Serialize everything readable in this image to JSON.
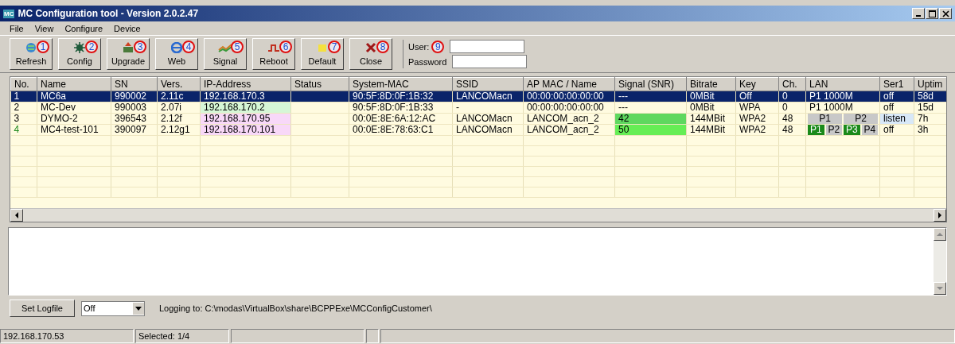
{
  "window": {
    "title": "MC Configuration tool - Version 2.0.2.47",
    "logo": "MC"
  },
  "menu": [
    "File",
    "View",
    "Configure",
    "Device"
  ],
  "toolbar": [
    {
      "label": "Refresh",
      "callout": "1"
    },
    {
      "label": "Config",
      "callout": "2"
    },
    {
      "label": "Upgrade",
      "callout": "3"
    },
    {
      "label": "Web",
      "callout": "4"
    },
    {
      "label": "Signal",
      "callout": "5"
    },
    {
      "label": "Reboot",
      "callout": "6"
    },
    {
      "label": "Default",
      "callout": "7"
    },
    {
      "label": "Close",
      "callout": "8"
    }
  ],
  "login": {
    "user_label": "User:",
    "callout": "9",
    "password_label": "Password"
  },
  "table": {
    "columns": [
      "No.",
      "Name",
      "SN",
      "Vers.",
      "IP-Address",
      "Status",
      "System-MAC",
      "SSID",
      "AP MAC / Name",
      "Signal (SNR)",
      "Bitrate",
      "Key",
      "Ch.",
      "LAN",
      "Ser1",
      "Uptim"
    ],
    "rows": [
      {
        "selected": true,
        "cells": [
          "1",
          "MC6a",
          "990002",
          "2.11c",
          "192.168.170.3",
          "",
          "90:5F:8D:0F:1B:32",
          "LANCOMacn",
          "00:00:00:00:00:00",
          "---",
          "0MBit",
          "Off",
          "0",
          "P1 1000M",
          "off",
          "58d"
        ]
      },
      {
        "selected": false,
        "cells": [
          "2",
          "MC-Dev",
          "990003",
          "2.07i",
          {
            "kind": "fill",
            "text": "192.168.170.2",
            "color": "#d6f7d6"
          },
          "",
          "90:5F:8D:0F:1B:33",
          "-",
          "00:00:00:00:00:00",
          "---",
          "0MBit",
          "WPA",
          "0",
          "P1 1000M",
          "off",
          "15d"
        ]
      },
      {
        "selected": false,
        "cells": [
          "3",
          "DYMO-2",
          "396543",
          "2.12f",
          {
            "kind": "fill",
            "text": "192.168.170.95",
            "color": "#f8d8f8"
          },
          "",
          "00:0E:8E:6A:12:AC",
          "LANCOMacn",
          "LANCOM_acn_2",
          {
            "kind": "fill",
            "text": "42",
            "color": "#5fd85f"
          },
          "144MBit",
          "WPA2",
          "48",
          {
            "kind": "ports",
            "ports": [
              {
                "label": "P1",
                "on": false
              },
              {
                "label": "P2",
                "on": false
              }
            ]
          },
          {
            "kind": "fill",
            "text": "listen",
            "color": "#d8e8f8"
          },
          "7h"
        ]
      },
      {
        "selected": false,
        "cells": [
          {
            "kind": "ink",
            "text": "4",
            "color": "#1f8a1f"
          },
          "MC4-test-101",
          "390097",
          "2.12g1",
          {
            "kind": "fill",
            "text": "192.168.170.101",
            "color": "#f8d8f8"
          },
          "",
          "00:0E:8E:78:63:C1",
          "LANCOMacn",
          "LANCOM_acn_2",
          {
            "kind": "fill",
            "text": "50",
            "color": "#66ee55"
          },
          "144MBit",
          "WPA2",
          "48",
          {
            "kind": "ports",
            "ports": [
              {
                "label": "P1",
                "on": true
              },
              {
                "label": "P2",
                "on": false
              },
              {
                "label": "P3",
                "on": true
              },
              {
                "label": "P4",
                "on": false
              }
            ]
          },
          "off",
          "3h"
        ]
      }
    ]
  },
  "log": {
    "button": "Set Logfile",
    "mode": "Off",
    "path": "Logging to: C:\\modas\\VirtualBox\\share\\BCPPExe\\MCConfigCustomer\\"
  },
  "status_bar": [
    "192.168.170.53",
    "Selected: 1/4"
  ]
}
